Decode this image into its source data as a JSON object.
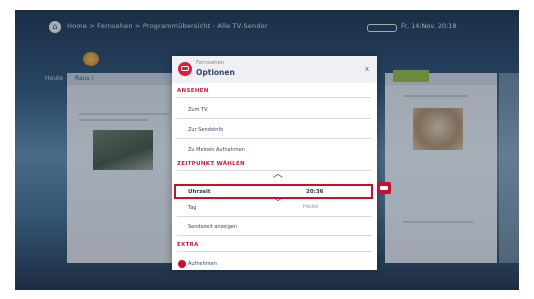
{
  "topbar": {
    "breadcrumb": "Home > Fernsehen > Programmübersicht - Alle TV-Sender",
    "status": "Fr, 14:Nov. 20:18"
  },
  "background": {
    "left_tab": "Heute",
    "left_card_header": "Raus !"
  },
  "panel": {
    "brand": "Fernsehen",
    "title": "Optionen",
    "close": "x",
    "sections": {
      "ansehen": "ANSEHEN",
      "zeitpunkt": "ZEITPUNKT WÄHLEN",
      "extra": "EXTRA"
    },
    "items": {
      "live_tv": "Zum TV",
      "sendeinfo": "Zur Sendeinfo",
      "aufnahmen": "Zu Meinen Aufnahmen",
      "tag": "Tag",
      "sendezeit": "Sendezeit anzeigen",
      "aufnehmen": "Aufnehmen"
    },
    "uhrzeit": {
      "label": "Uhrzeit",
      "value": "20:36"
    },
    "tag_value": "Heute"
  },
  "colors": {
    "accent": "#c8102e",
    "panel_header": "#eef0f3"
  }
}
